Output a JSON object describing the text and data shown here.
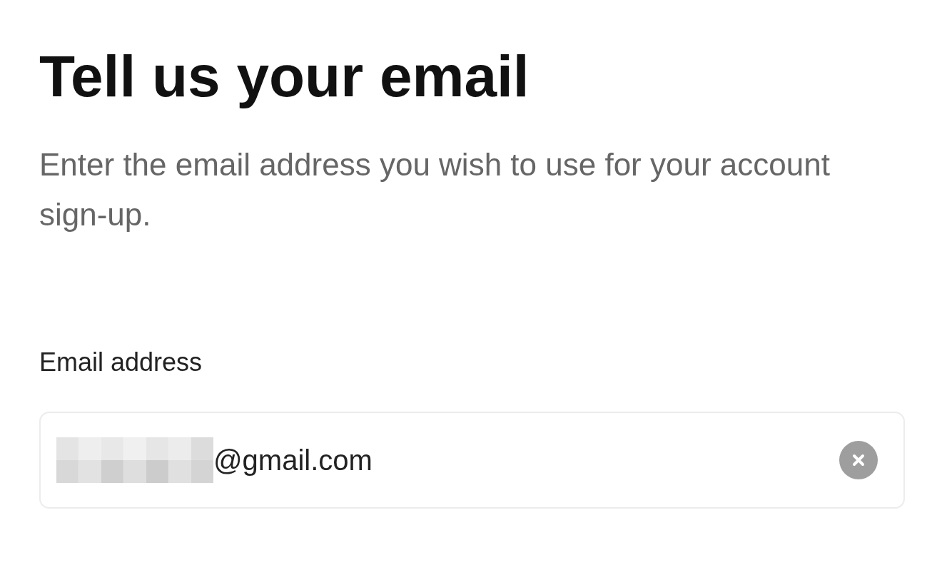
{
  "title": "Tell us your email",
  "description": "Enter the email address you wish to use for your account sign-up.",
  "email_field": {
    "label": "Email address",
    "value": "@gmail.com",
    "redacted_prefix": true,
    "clearable": true
  }
}
